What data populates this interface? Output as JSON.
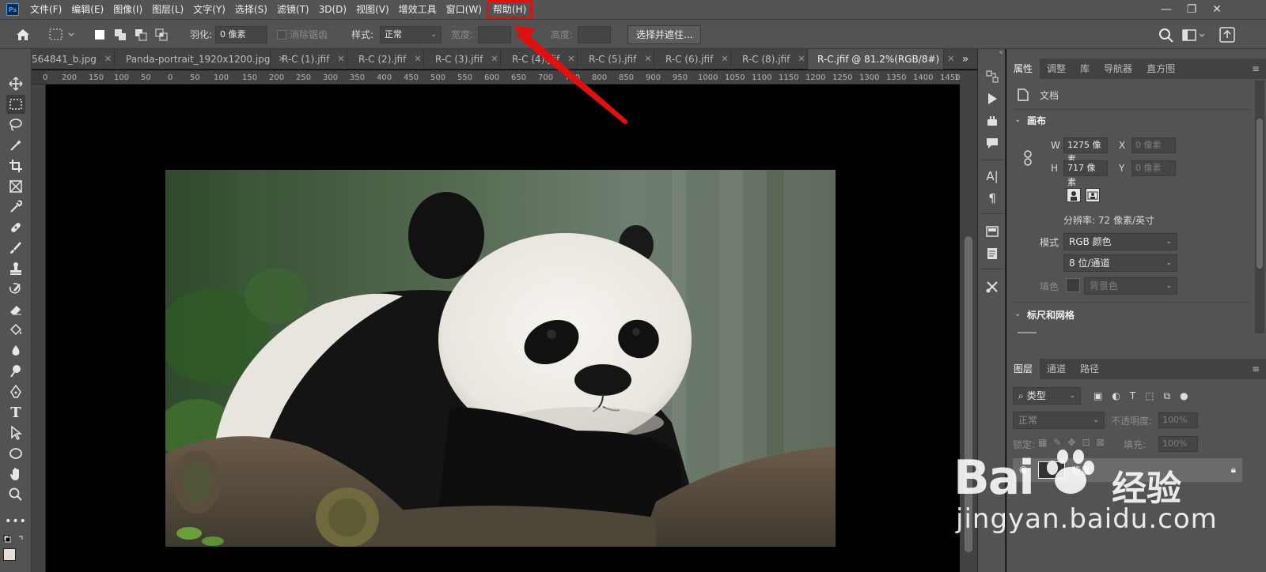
{
  "menubar": {
    "logo": "Ps",
    "items": [
      "文件(F)",
      "编辑(E)",
      "图像(I)",
      "图层(L)",
      "文字(Y)",
      "选择(S)",
      "滤镜(T)",
      "3D(D)",
      "视图(V)",
      "增效工具",
      "窗口(W)",
      "帮助(H)"
    ],
    "highlighted": "帮助(H)",
    "window_controls": [
      "—",
      "❐",
      "✕"
    ]
  },
  "options": {
    "feather_label": "羽化:",
    "feather_value": "0 像素",
    "antialias_label": "消除锯齿",
    "style_label": "样式:",
    "style_value": "正常",
    "width_label": "宽度:",
    "height_label": "高度:",
    "select_mask_button": "选择并遮住..."
  },
  "tabs": [
    {
      "label": "564841_b.jpg",
      "active": false
    },
    {
      "label": "Panda-portrait_1920x1200.jpg",
      "active": false
    },
    {
      "label": "R-C (1).jfif",
      "active": false
    },
    {
      "label": "R-C (2).jfif",
      "active": false
    },
    {
      "label": "R-C (3).jfif",
      "active": false
    },
    {
      "label": "R-C (4).jfif",
      "active": false
    },
    {
      "label": "R-C (5).jfif",
      "active": false
    },
    {
      "label": "R-C (6).jfif",
      "active": false
    },
    {
      "label": "R-C (8).jfif",
      "active": false
    },
    {
      "label": "R-C.jfif @ 81.2%(RGB/8#)",
      "active": true
    }
  ],
  "tab_overflow": "»",
  "ruler": {
    "top_ticks": [
      "0",
      "200",
      "150",
      "100",
      "50",
      "0",
      "50",
      "100",
      "150",
      "200",
      "250",
      "300",
      "350",
      "400",
      "450",
      "500",
      "550",
      "600",
      "650",
      "700",
      "750",
      "800",
      "850",
      "900",
      "950",
      "1000",
      "1050",
      "1100",
      "1150",
      "1200",
      "1250",
      "1300",
      "1350",
      "1400",
      "1450",
      "15"
    ]
  },
  "properties_panel": {
    "tabs": [
      "属性",
      "调整",
      "库",
      "导航器",
      "直方图"
    ],
    "doc_label": "文档",
    "canvas_section": "画布",
    "w_label": "W",
    "w_value": "1275 像素",
    "h_label": "H",
    "h_value": "717 像素",
    "x_label": "X",
    "x_value": "0 像素",
    "y_label": "Y",
    "y_value": "0 像素",
    "resolution": "分辨率: 72 像素/英寸",
    "mode_label": "模式",
    "mode_value": "RGB 颜色",
    "depth_value": "8 位/通道",
    "fill_label": "填色",
    "fill_value": "背景色",
    "rulers_section": "标尺和网格"
  },
  "layers_panel": {
    "tabs": [
      "图层",
      "通道",
      "路径"
    ],
    "filter_label": "类型",
    "blend_mode": "正常",
    "opacity_label": "不透明度:",
    "opacity_value": "100%",
    "lock_label": "锁定:",
    "fill_label": "填充:",
    "fill_value": "100%",
    "layer_name": "背景"
  },
  "watermark": {
    "brand": "Bai",
    "brand_cn": "经验",
    "url": "jingyan.baidu.com"
  },
  "colors": {
    "annotation_red": "#e01010",
    "ui_gray": "#535353",
    "ui_dark": "#424242",
    "canvas_bg": "#000000"
  }
}
